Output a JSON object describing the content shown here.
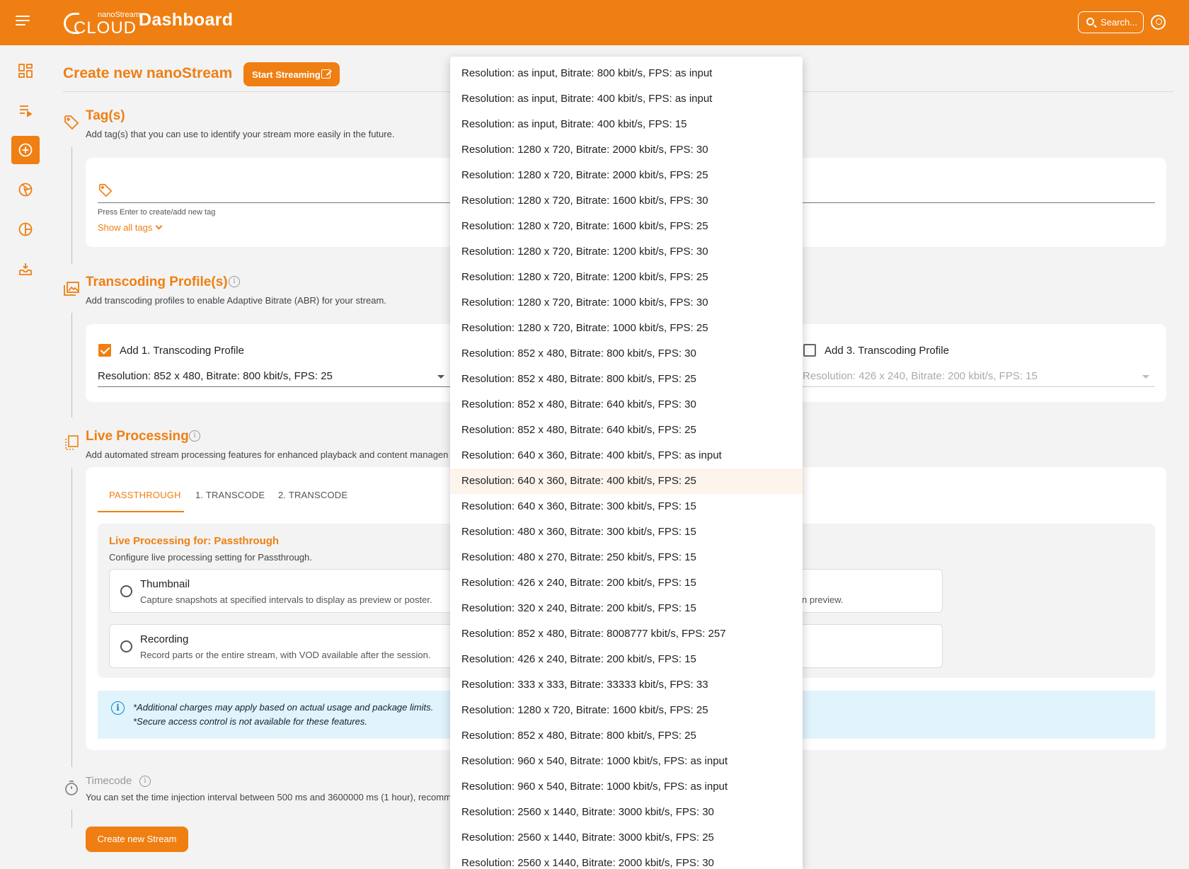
{
  "header": {
    "logo_small": "nanoStream",
    "logo_big": "CLOUD",
    "app_title": "Dashboard",
    "search_placeholder": "Search..."
  },
  "colors": {
    "brand": "#ef7f12",
    "info": "#0b84c6",
    "notice_bg": "#e1f3fb"
  },
  "sidebar": {
    "items": [
      {
        "icon": "dashboard-grid-icon",
        "active": false
      },
      {
        "icon": "stream-list-icon",
        "active": false
      },
      {
        "icon": "add-circle-icon",
        "active": true
      },
      {
        "icon": "aperture-icon",
        "active": false
      },
      {
        "icon": "pie-chart-icon",
        "active": false
      },
      {
        "icon": "inbox-download-icon",
        "active": false
      }
    ]
  },
  "page": {
    "title": "Create new nanoStream",
    "start_streaming_label": "Start Streaming"
  },
  "tags": {
    "title": "Tag(s)",
    "description": "Add tag(s) that you can use to identify your stream more easily in the future.",
    "hint": "Press Enter to create/add new tag",
    "show_all": "Show all tags"
  },
  "transcoding": {
    "title": "Transcoding Profile(s)",
    "description": "Add transcoding profiles to enable Adaptive Bitrate (ABR) for your stream.",
    "profile1": {
      "label": "Add 1. Transcoding Profile",
      "checked": true,
      "value": "Resolution: 852 x 480, Bitrate: 800 kbit/s, FPS: 25"
    },
    "profile3": {
      "label": "Add 3. Transcoding Profile",
      "checked": false,
      "value": "Resolution: 426 x 240, Bitrate: 200 kbit/s, FPS: 15"
    }
  },
  "live_processing": {
    "title": "Live Processing",
    "description": "Add automated stream processing features for enhanced playback and content managen",
    "tabs": [
      "PASSTHROUGH",
      "1. TRANSCODE",
      "2. TRANSCODE"
    ],
    "active_tab": "PASSTHROUGH",
    "panel_title": "Live Processing for: Passthrough",
    "panel_description": "Configure live processing setting for Passthrough.",
    "options": [
      {
        "title": "Thumbnail",
        "description": "Capture snapshots at specified intervals to display as preview or poster.",
        "right_text": "n preview."
      },
      {
        "title": "Recording",
        "description": "Record parts or the entire stream, with VOD available after the session."
      }
    ],
    "notice_lines": [
      "*Additional charges may apply based on actual usage and package limits.",
      "*Secure access control is not available for these features."
    ]
  },
  "timecode": {
    "title": "Timecode",
    "description": "You can set the time injection interval between 500 ms and 3600000 ms (1 hour), recomm"
  },
  "create_button": "Create new Stream",
  "dropdown": {
    "hover_index": 16,
    "options": [
      "Resolution: as input, Bitrate: 800 kbit/s, FPS: as input",
      "Resolution: as input, Bitrate: 400 kbit/s, FPS: as input",
      "Resolution: as input, Bitrate: 400 kbit/s, FPS: 15",
      "Resolution: 1280 x 720, Bitrate: 2000 kbit/s, FPS: 30",
      "Resolution: 1280 x 720, Bitrate: 2000 kbit/s, FPS: 25",
      "Resolution: 1280 x 720, Bitrate: 1600 kbit/s, FPS: 30",
      "Resolution: 1280 x 720, Bitrate: 1600 kbit/s, FPS: 25",
      "Resolution: 1280 x 720, Bitrate: 1200 kbit/s, FPS: 30",
      "Resolution: 1280 x 720, Bitrate: 1200 kbit/s, FPS: 25",
      "Resolution: 1280 x 720, Bitrate: 1000 kbit/s, FPS: 30",
      "Resolution: 1280 x 720, Bitrate: 1000 kbit/s, FPS: 25",
      "Resolution: 852 x 480, Bitrate: 800 kbit/s, FPS: 30",
      "Resolution: 852 x 480, Bitrate: 800 kbit/s, FPS: 25",
      "Resolution: 852 x 480, Bitrate: 640 kbit/s, FPS: 30",
      "Resolution: 852 x 480, Bitrate: 640 kbit/s, FPS: 25",
      "Resolution: 640 x 360, Bitrate: 400 kbit/s, FPS: as input",
      "Resolution: 640 x 360, Bitrate: 400 kbit/s, FPS: 25",
      "Resolution: 640 x 360, Bitrate: 300 kbit/s, FPS: 15",
      "Resolution: 480 x 360, Bitrate: 300 kbit/s, FPS: 15",
      "Resolution: 480 x 270, Bitrate: 250 kbit/s, FPS: 15",
      "Resolution: 426 x 240, Bitrate: 200 kbit/s, FPS: 15",
      "Resolution: 320 x 240, Bitrate: 200 kbit/s, FPS: 15",
      "Resolution: 852 x 480, Bitrate: 8008777 kbit/s, FPS: 257",
      "Resolution: 426 x 240, Bitrate: 200 kbit/s, FPS: 15",
      "Resolution: 333 x 333, Bitrate: 33333 kbit/s, FPS: 33",
      "Resolution: 1280 x 720, Bitrate: 1600 kbit/s, FPS: 25",
      "Resolution: 852 x 480, Bitrate: 800 kbit/s, FPS: 25",
      "Resolution: 960 x 540, Bitrate: 1000 kbit/s, FPS: as input",
      "Resolution: 960 x 540, Bitrate: 1000 kbit/s, FPS: as input",
      "Resolution: 2560 x 1440, Bitrate: 3000 kbit/s, FPS: 30",
      "Resolution: 2560 x 1440, Bitrate: 3000 kbit/s, FPS: 25",
      "Resolution: 2560 x 1440, Bitrate: 2000 kbit/s, FPS: 30"
    ]
  }
}
